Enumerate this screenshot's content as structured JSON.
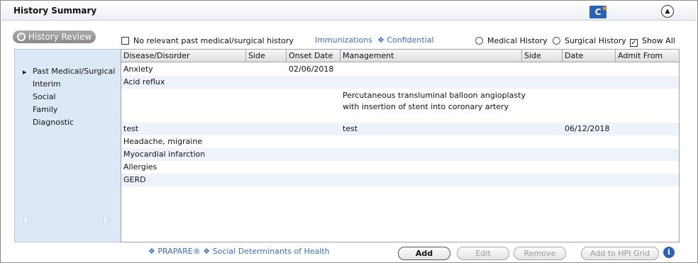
{
  "header": {
    "title": "History Summary",
    "app_icon_letter": "C",
    "collapse_glyph": "▲"
  },
  "toolbar": {
    "history_review_label": "History Review",
    "no_relevant_label": "No relevant past medical/surgical history",
    "immunizations_link": "Immunizations",
    "confidential_link": "❖ Confidential",
    "medical_history_label": "Medical History",
    "surgical_history_label": "Surgical History",
    "show_all_label": "Show All",
    "show_all_checked": true
  },
  "sidebar": {
    "items": [
      {
        "label": "Past Medical/Surgical",
        "selected": true
      },
      {
        "label": "Interim"
      },
      {
        "label": "Social"
      },
      {
        "label": "Family"
      },
      {
        "label": "Diagnostic"
      }
    ]
  },
  "grid": {
    "columns": [
      "Disease/Disorder",
      "Side",
      "Onset Date",
      "Management",
      "Side",
      "Date",
      "Admit From"
    ],
    "rows": [
      {
        "disease": "Anxiety",
        "onset": "02/06/2018",
        "management": "",
        "date": ""
      },
      {
        "disease": "Acid reflux",
        "onset": "",
        "management": "",
        "date": ""
      },
      {
        "disease": "",
        "onset": "",
        "management_line1": "Percutaneous transluminal balloon angioplasty",
        "management_line2": "with insertion of stent into coronary artery",
        "date": ""
      },
      {
        "disease": "test",
        "onset": "",
        "management": "test",
        "date": "06/12/2018"
      },
      {
        "disease": "Headache, migraine"
      },
      {
        "disease": "Myocardial infarction"
      },
      {
        "disease": "Allergies"
      },
      {
        "disease": "GERD"
      }
    ]
  },
  "footer": {
    "links": "❖ PRAPARE® ❖ Social Determinants of Health",
    "add_label": "Add",
    "edit_label": "Edit",
    "remove_label": "Remove",
    "add_hpi_label": "Add to HPI Grid",
    "info_glyph": "i"
  }
}
